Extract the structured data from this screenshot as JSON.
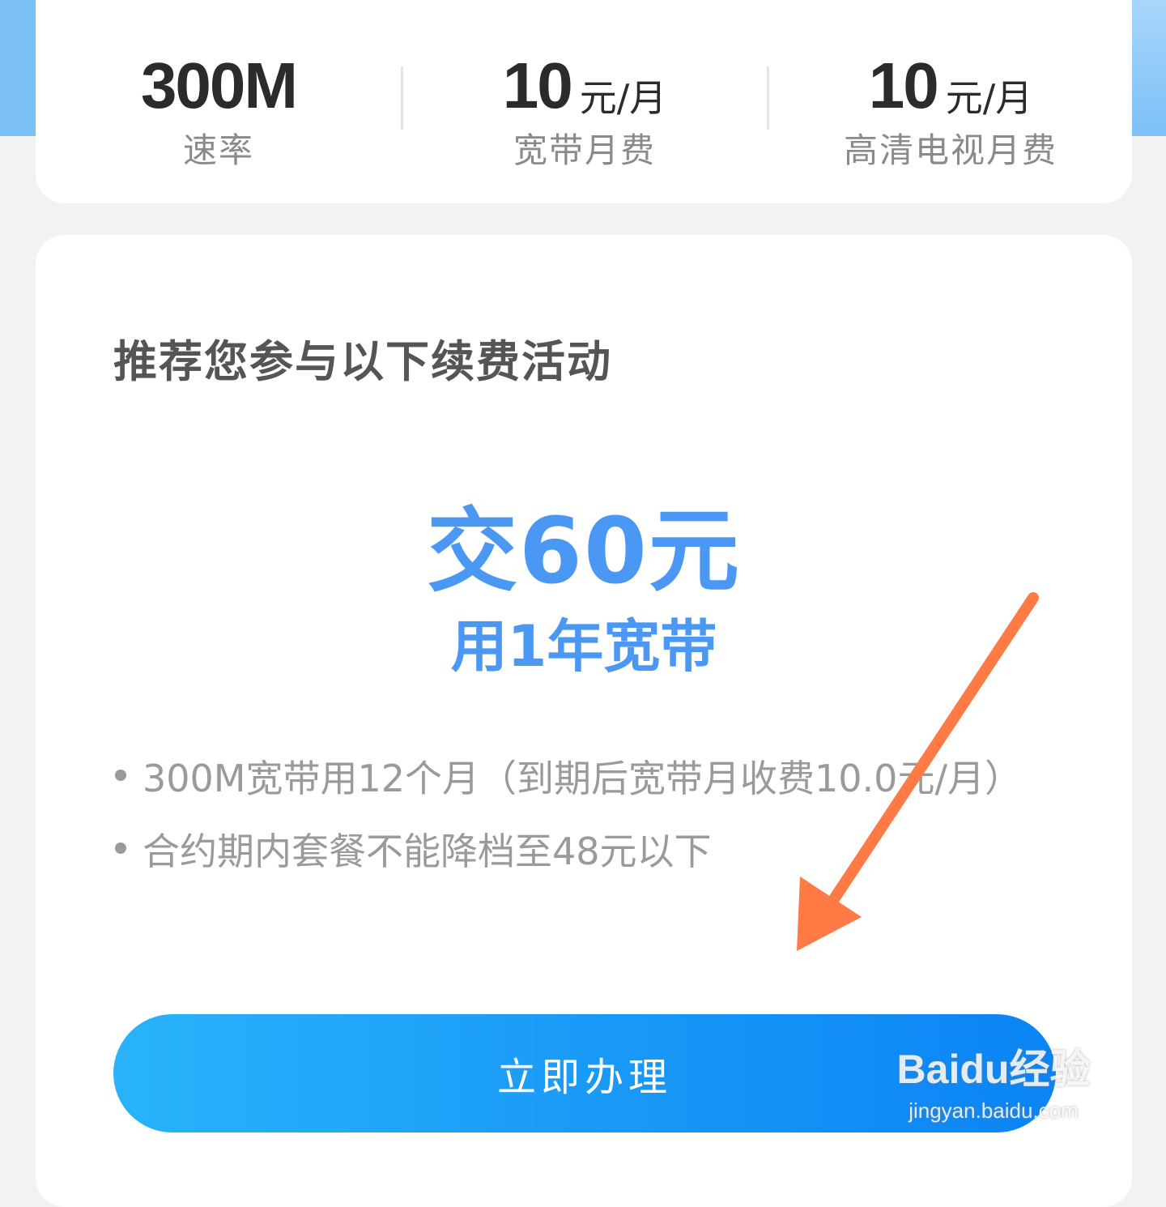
{
  "stats": [
    {
      "value": "300M",
      "unit": "",
      "label": "速率"
    },
    {
      "value": "10",
      "unit": "元/月",
      "label": "宽带月费"
    },
    {
      "value": "10",
      "unit": "元/月",
      "label": "高清电视月费"
    }
  ],
  "promo": {
    "section_title": "推荐您参与以下续费活动",
    "headline": "交60元",
    "subline": "用1年宽带",
    "bullets": [
      "300M宽带用12个月（到期后宽带月收费10.0元/月）",
      "合约期内套餐不能降档至48元以下"
    ],
    "cta_label": "立即办理"
  },
  "watermark": {
    "logo": "Baidu经验",
    "url": "jingyan.baidu.com"
  },
  "colors": {
    "accent": "#4b98f4",
    "arrow": "#ff7a45",
    "button_start": "#29b3fb",
    "button_end": "#0b84f5"
  }
}
